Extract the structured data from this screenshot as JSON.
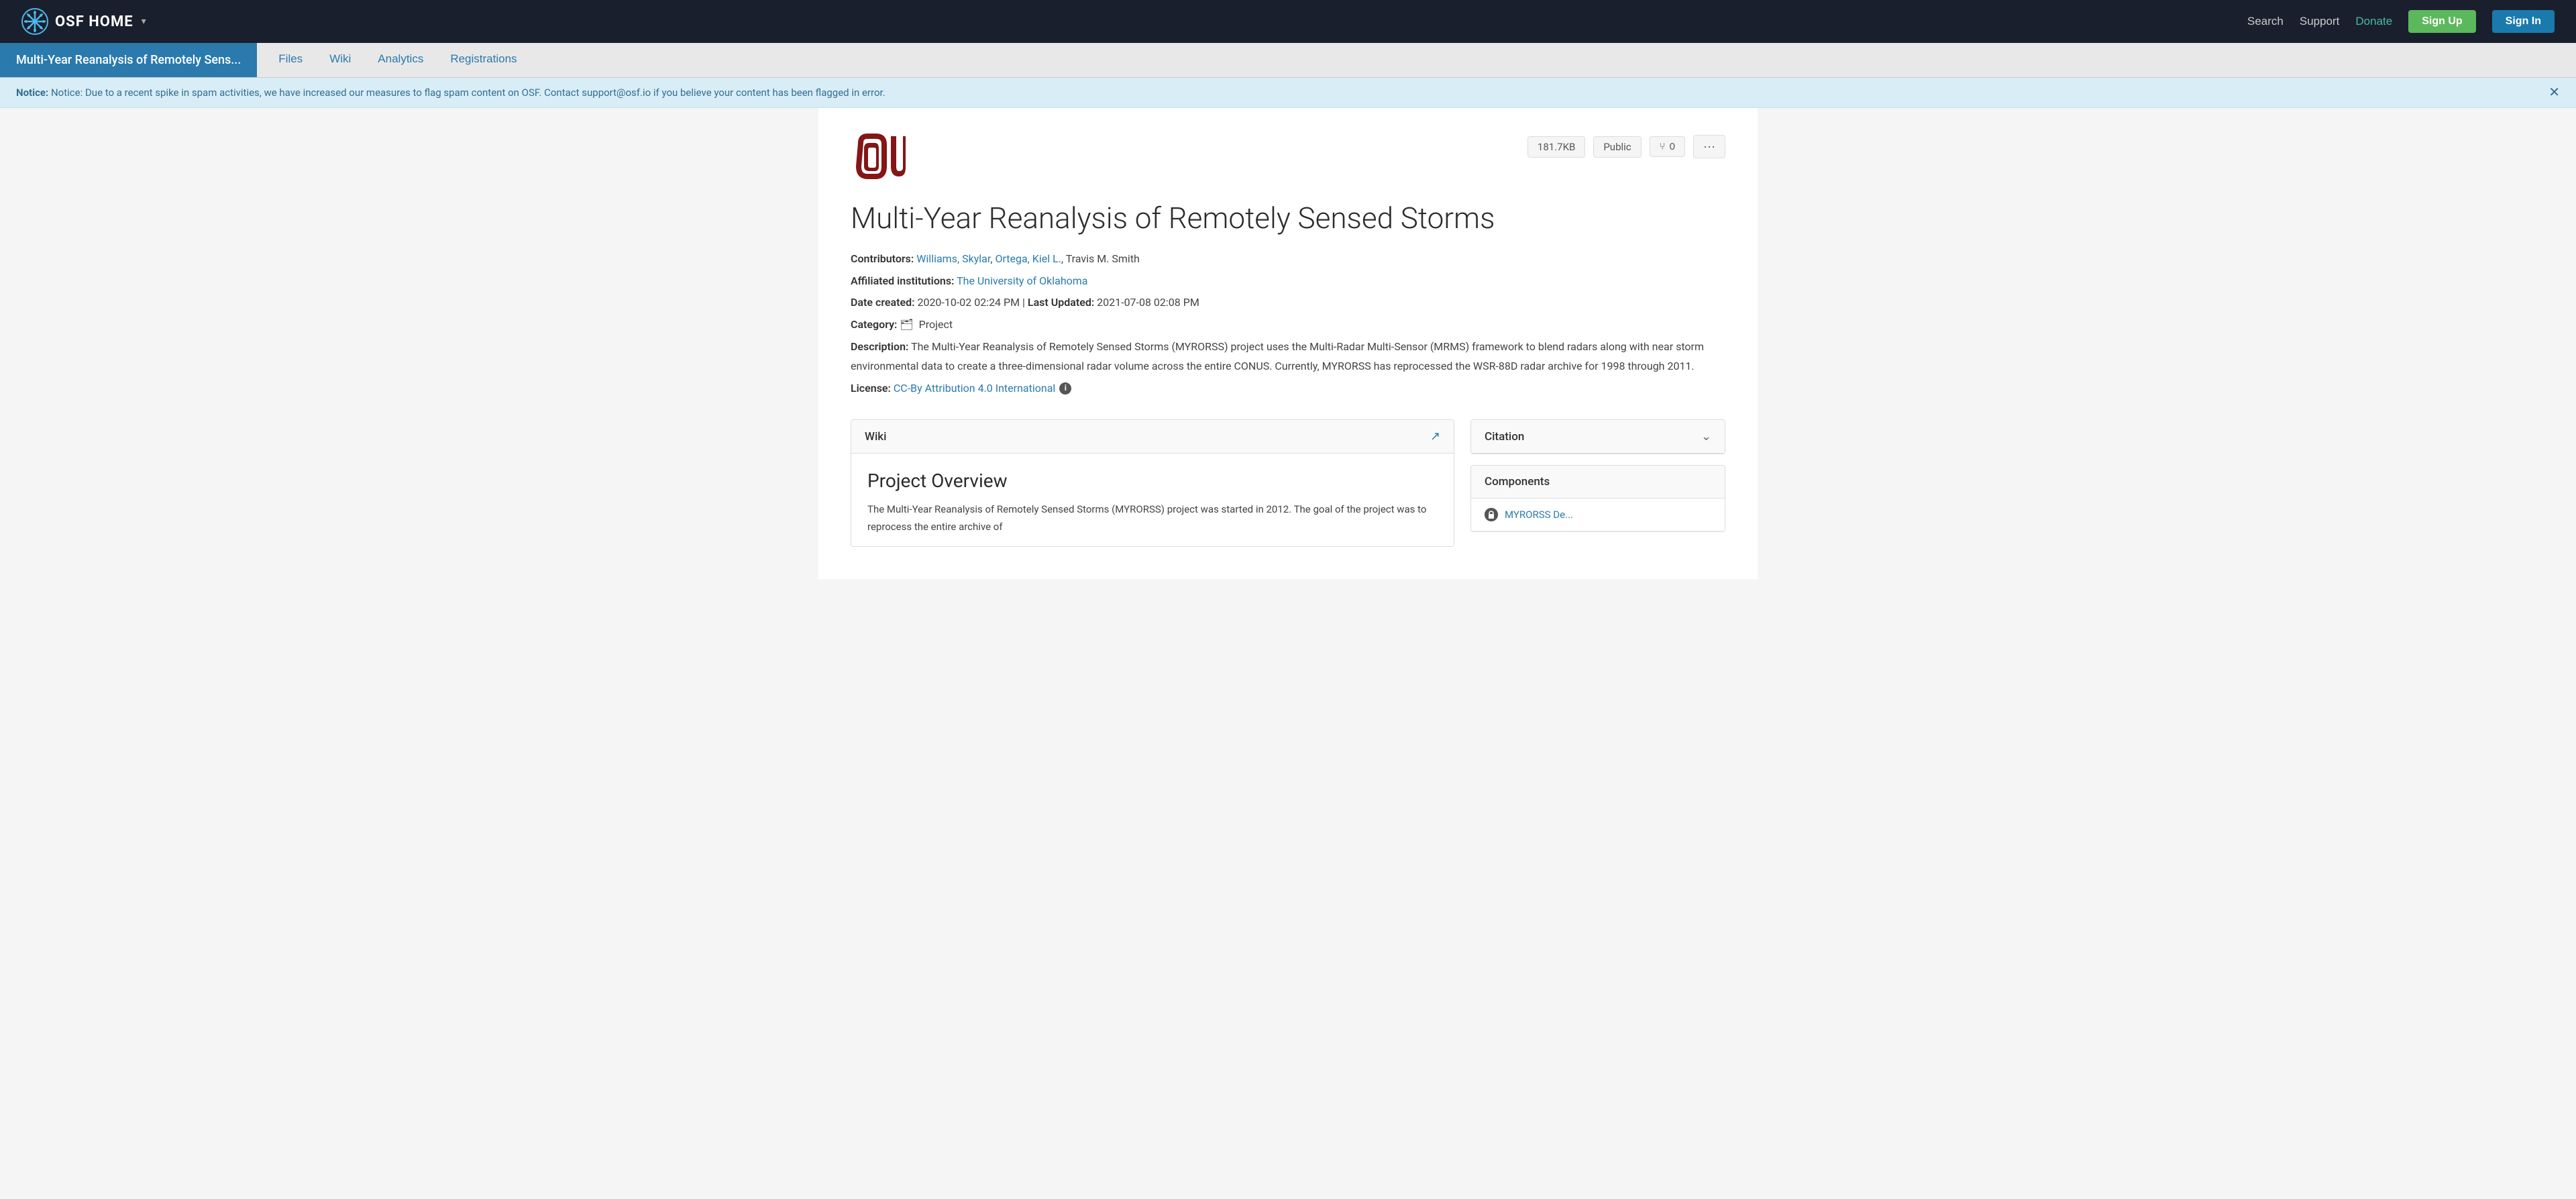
{
  "navbar": {
    "brand": "OSF HOME",
    "brand_arrow": "▾",
    "links": {
      "search": "Search",
      "support": "Support",
      "donate": "Donate",
      "signup": "Sign Up",
      "signin": "Sign In"
    }
  },
  "project_nav": {
    "title": "Multi-Year Reanalysis of Remotely Sens...",
    "tabs": [
      {
        "label": "Files",
        "id": "files"
      },
      {
        "label": "Wiki",
        "id": "wiki"
      },
      {
        "label": "Analytics",
        "id": "analytics"
      },
      {
        "label": "Registrations",
        "id": "registrations"
      }
    ]
  },
  "notice": {
    "prefix": "Notice:",
    "text": " Notice: Due to a recent spike in spam activities, we have increased our measures to flag spam content on OSF. Contact support@osf.io if you believe your content has been flagged in error."
  },
  "project": {
    "file_size": "181.7KB",
    "visibility": "Public",
    "forks": "0",
    "title": "Multi-Year Reanalysis of Remotely Sensed Storms",
    "contributors_label": "Contributors:",
    "contributors": [
      {
        "name": "Williams, Skylar",
        "linked": true
      },
      {
        "name": "Ortega, Kiel L.",
        "linked": true
      },
      {
        "name": "Travis M. Smith",
        "linked": false
      }
    ],
    "affiliated_label": "Affiliated institutions:",
    "affiliated_institution": "The University of Oklahoma",
    "date_label": "Date created:",
    "date_created": "2020-10-02 02:24 PM",
    "date_updated_label": "Last Updated:",
    "date_updated": "2021-07-08 02:08 PM",
    "category_label": "Category:",
    "category_icon": "🗂",
    "category": "Project",
    "description_label": "Description:",
    "description": "The Multi-Year Reanalysis of Remotely Sensed Storms (MYRORSS) project uses the Multi-Radar Multi-Sensor (MRMS) framework to blend radars along with near storm environmental data to create a three-dimensional radar volume across the entire CONUS. Currently, MYRORSS has reprocessed the WSR-88D radar archive for 1998 through 2011.",
    "license_label": "License:",
    "license": "CC-By Attribution 4.0 International"
  },
  "wiki_panel": {
    "header": "Wiki",
    "wiki_title": "Project Overview",
    "wiki_text": "The Multi-Year Reanalysis of Remotely Sensed Storms (MYRORSS) project was started in 2012. The goal of the project was to reprocess the entire archive of"
  },
  "citation_panel": {
    "header": "Citation"
  },
  "components_panel": {
    "header": "Components",
    "items": [
      {
        "name": "MYRORSS De..."
      }
    ]
  }
}
